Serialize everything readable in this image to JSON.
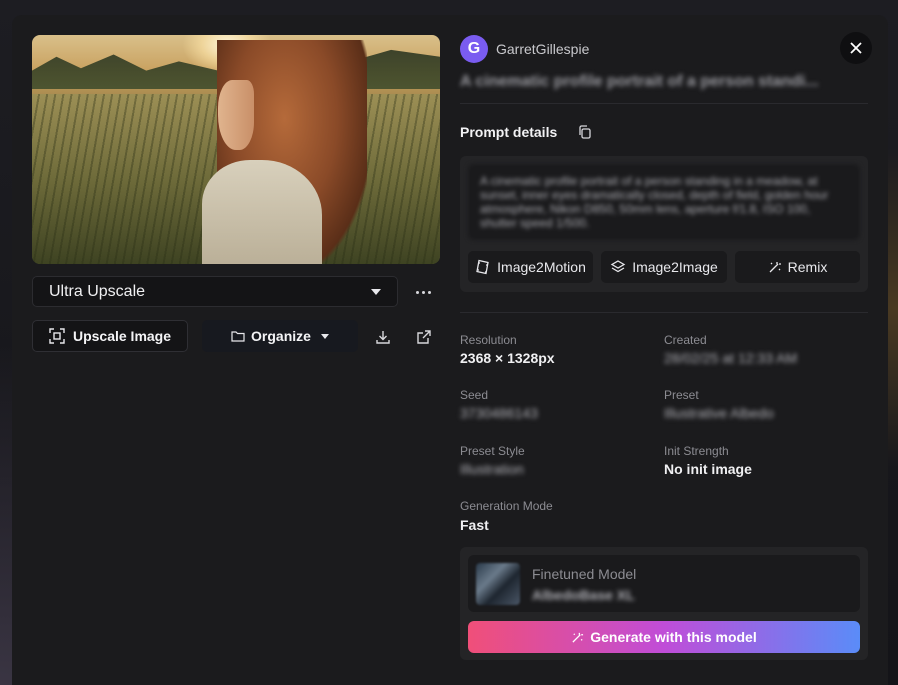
{
  "header": {
    "avatar_letter": "G",
    "username": "GarretGillespie",
    "title": "A cinematic profile portrait of a person standi..."
  },
  "left": {
    "upscale_select": "Ultra Upscale",
    "upscale_button": "Upscale Image",
    "organize_button": "Organize"
  },
  "prompt": {
    "label": "Prompt details",
    "text": "A cinematic profile portrait of a person standing in a meadow, at sunset, inner eyes dramatically closed, depth of field, golden hour atmosphere, Nikon D850, 50mm lens, aperture f/1.8, ISO 100, shutter speed 1/500.",
    "actions": [
      "Image2Motion",
      "Image2Image",
      "Remix"
    ]
  },
  "meta": {
    "resolution_label": "Resolution",
    "resolution": "2368 × 1328px",
    "created_label": "Created",
    "created": "28/02/25 at 12:33 AM",
    "seed_label": "Seed",
    "seed": "3730486143",
    "preset_label": "Preset",
    "preset": "Illustrative Albedo",
    "preset_style_label": "Preset Style",
    "preset_style": "Illustration",
    "init_strength_label": "Init Strength",
    "init_strength": "No init image",
    "generation_mode_label": "Generation Mode",
    "generation_mode": "Fast"
  },
  "model": {
    "label": "Finetuned Model",
    "name": "AlbedoBase XL",
    "generate_button": "Generate with this model"
  },
  "colors": {
    "accent_avatar": "#7a5cf0",
    "gradient_start": "#f04f79",
    "gradient_mid": "#c04dd8",
    "gradient_end": "#5a8cf8"
  }
}
